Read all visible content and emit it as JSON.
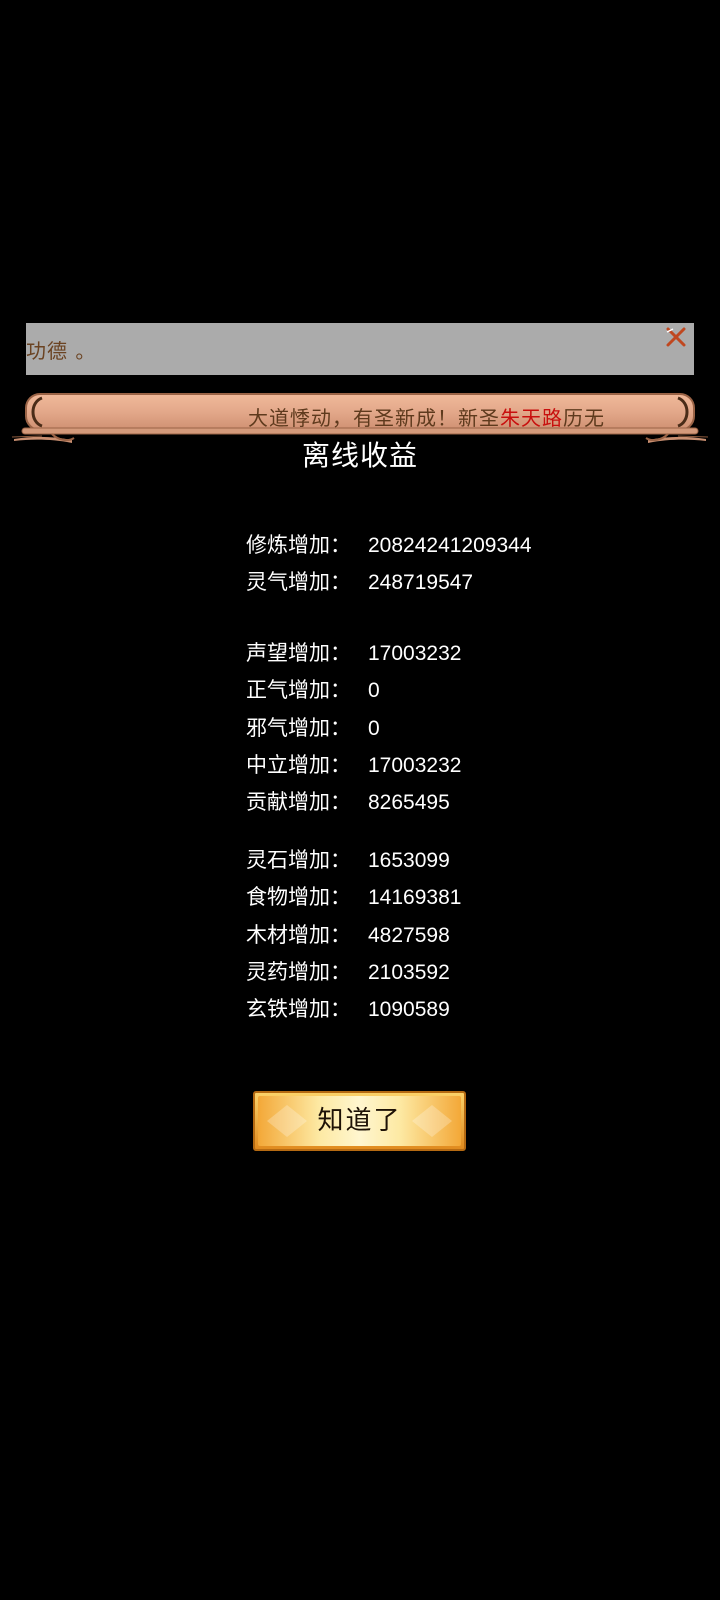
{
  "notice": {
    "text": "功德 。",
    "close_icon": "close-x-icon"
  },
  "banner": {
    "text_before": "大道悸动，有圣新成！新圣",
    "highlight_name": "朱天路",
    "text_after": "历无",
    "highlight_color": "#c8100e"
  },
  "dialog": {
    "title": "离线收益",
    "groups": [
      [
        {
          "label": "修炼增加：",
          "value": "20824241209344"
        },
        {
          "label": "灵气增加：",
          "value": "248719547"
        }
      ],
      [
        {
          "label": "声望增加：",
          "value": "17003232"
        },
        {
          "label": "正气增加：",
          "value": "0"
        },
        {
          "label": "邪气增加：",
          "value": "0"
        },
        {
          "label": "中立增加：",
          "value": "17003232"
        },
        {
          "label": "贡献增加：",
          "value": "8265495"
        }
      ],
      [
        {
          "label": "灵石增加：",
          "value": "1653099"
        },
        {
          "label": "食物增加：",
          "value": "14169381"
        },
        {
          "label": "木材增加：",
          "value": "4827598"
        },
        {
          "label": "灵药增加：",
          "value": "2103592"
        },
        {
          "label": "玄铁增加：",
          "value": "1090589"
        }
      ]
    ],
    "confirm_label": "知道了"
  }
}
